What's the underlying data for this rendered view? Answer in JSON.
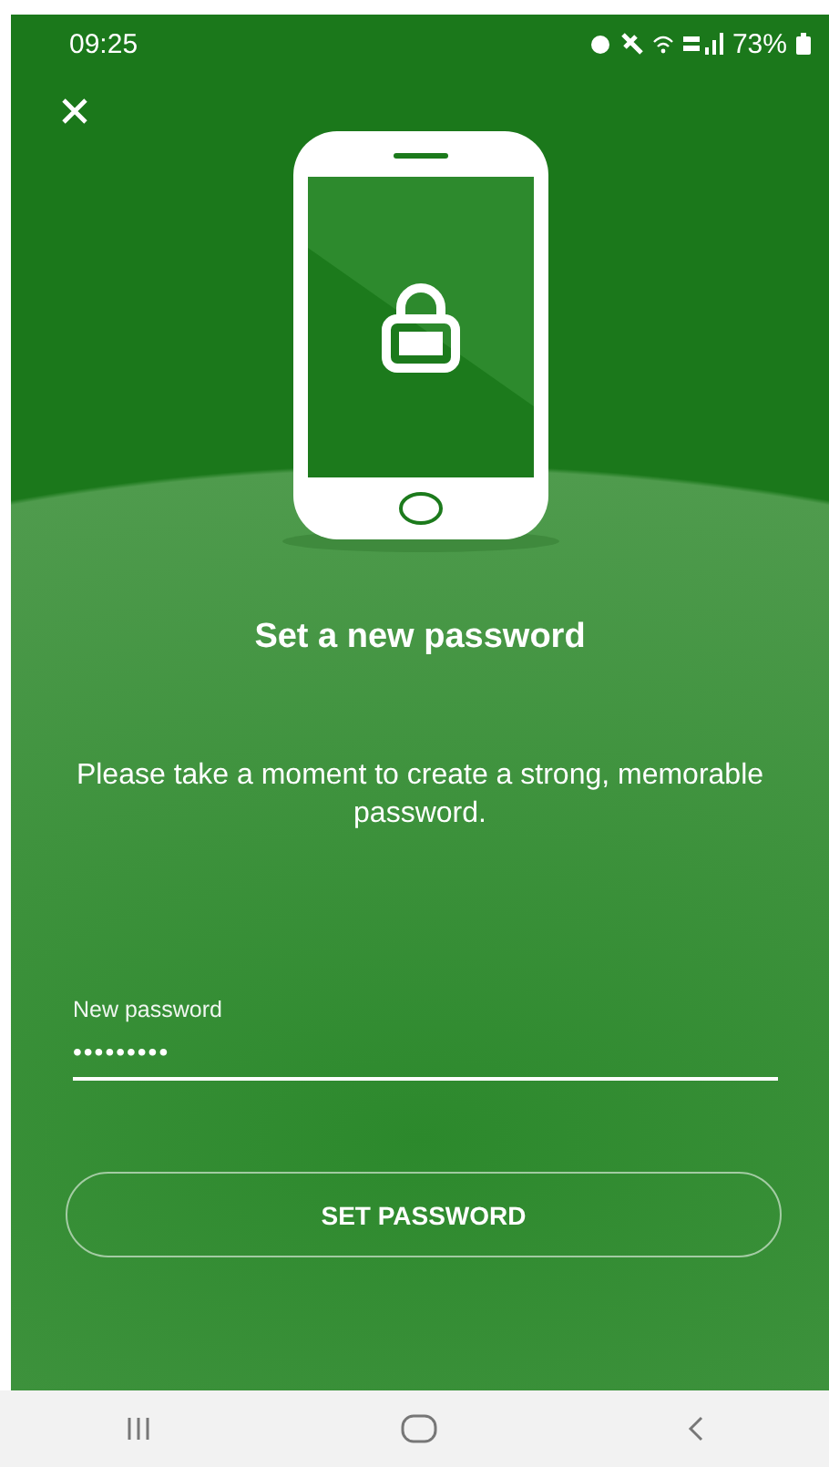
{
  "status_bar": {
    "time": "09:25",
    "battery": "73%"
  },
  "title": "Set a new password",
  "message": "Please take a moment to create a strong, memorable password.",
  "password_field": {
    "label": "New password",
    "value": "•••••••••"
  },
  "button": {
    "label": "SET PASSWORD"
  }
}
